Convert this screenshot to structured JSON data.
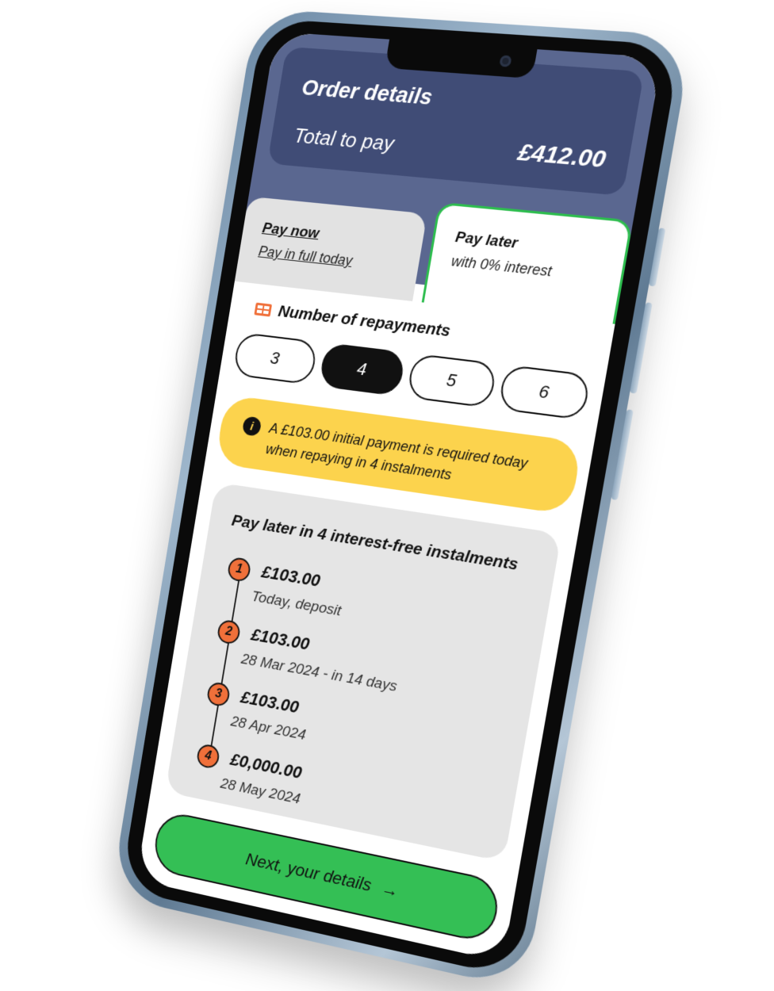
{
  "order": {
    "title": "Order details",
    "total_label": "Total to pay",
    "total_value": "£412.00"
  },
  "tabs": [
    {
      "title": "Pay now",
      "subtitle": "Pay in full today",
      "selected": false
    },
    {
      "title": "Pay later",
      "subtitle": "with 0% interest",
      "selected": true
    }
  ],
  "repayments": {
    "heading": "Number of repayments",
    "icon": "calendar-grid-icon",
    "options": [
      "3",
      "4",
      "5",
      "6"
    ],
    "selected": "4"
  },
  "info": {
    "icon": "info-icon",
    "icon_glyph": "i",
    "text": "A £103.00 initial payment is required today when repaying in 4 instalments"
  },
  "plan": {
    "title": "Pay later in 4 interest-free instalments",
    "steps": [
      {
        "number": "1",
        "amount": "£103.00",
        "date": "Today, deposit"
      },
      {
        "number": "2",
        "amount": "£103.00",
        "date": "28 Mar 2024 - in 14 days"
      },
      {
        "number": "3",
        "amount": "£103.00",
        "date": "28 Apr 2024"
      },
      {
        "number": "4",
        "amount": "£0,000.00",
        "date": "28 May 2024"
      }
    ]
  },
  "next_button": {
    "label": "Next, your details",
    "arrow": "→"
  },
  "colors": {
    "header": "#5a6790",
    "order_card": "#404c76",
    "accent_green": "#34bf55",
    "info_yellow": "#fcd34d",
    "step_orange": "#f0703a"
  }
}
